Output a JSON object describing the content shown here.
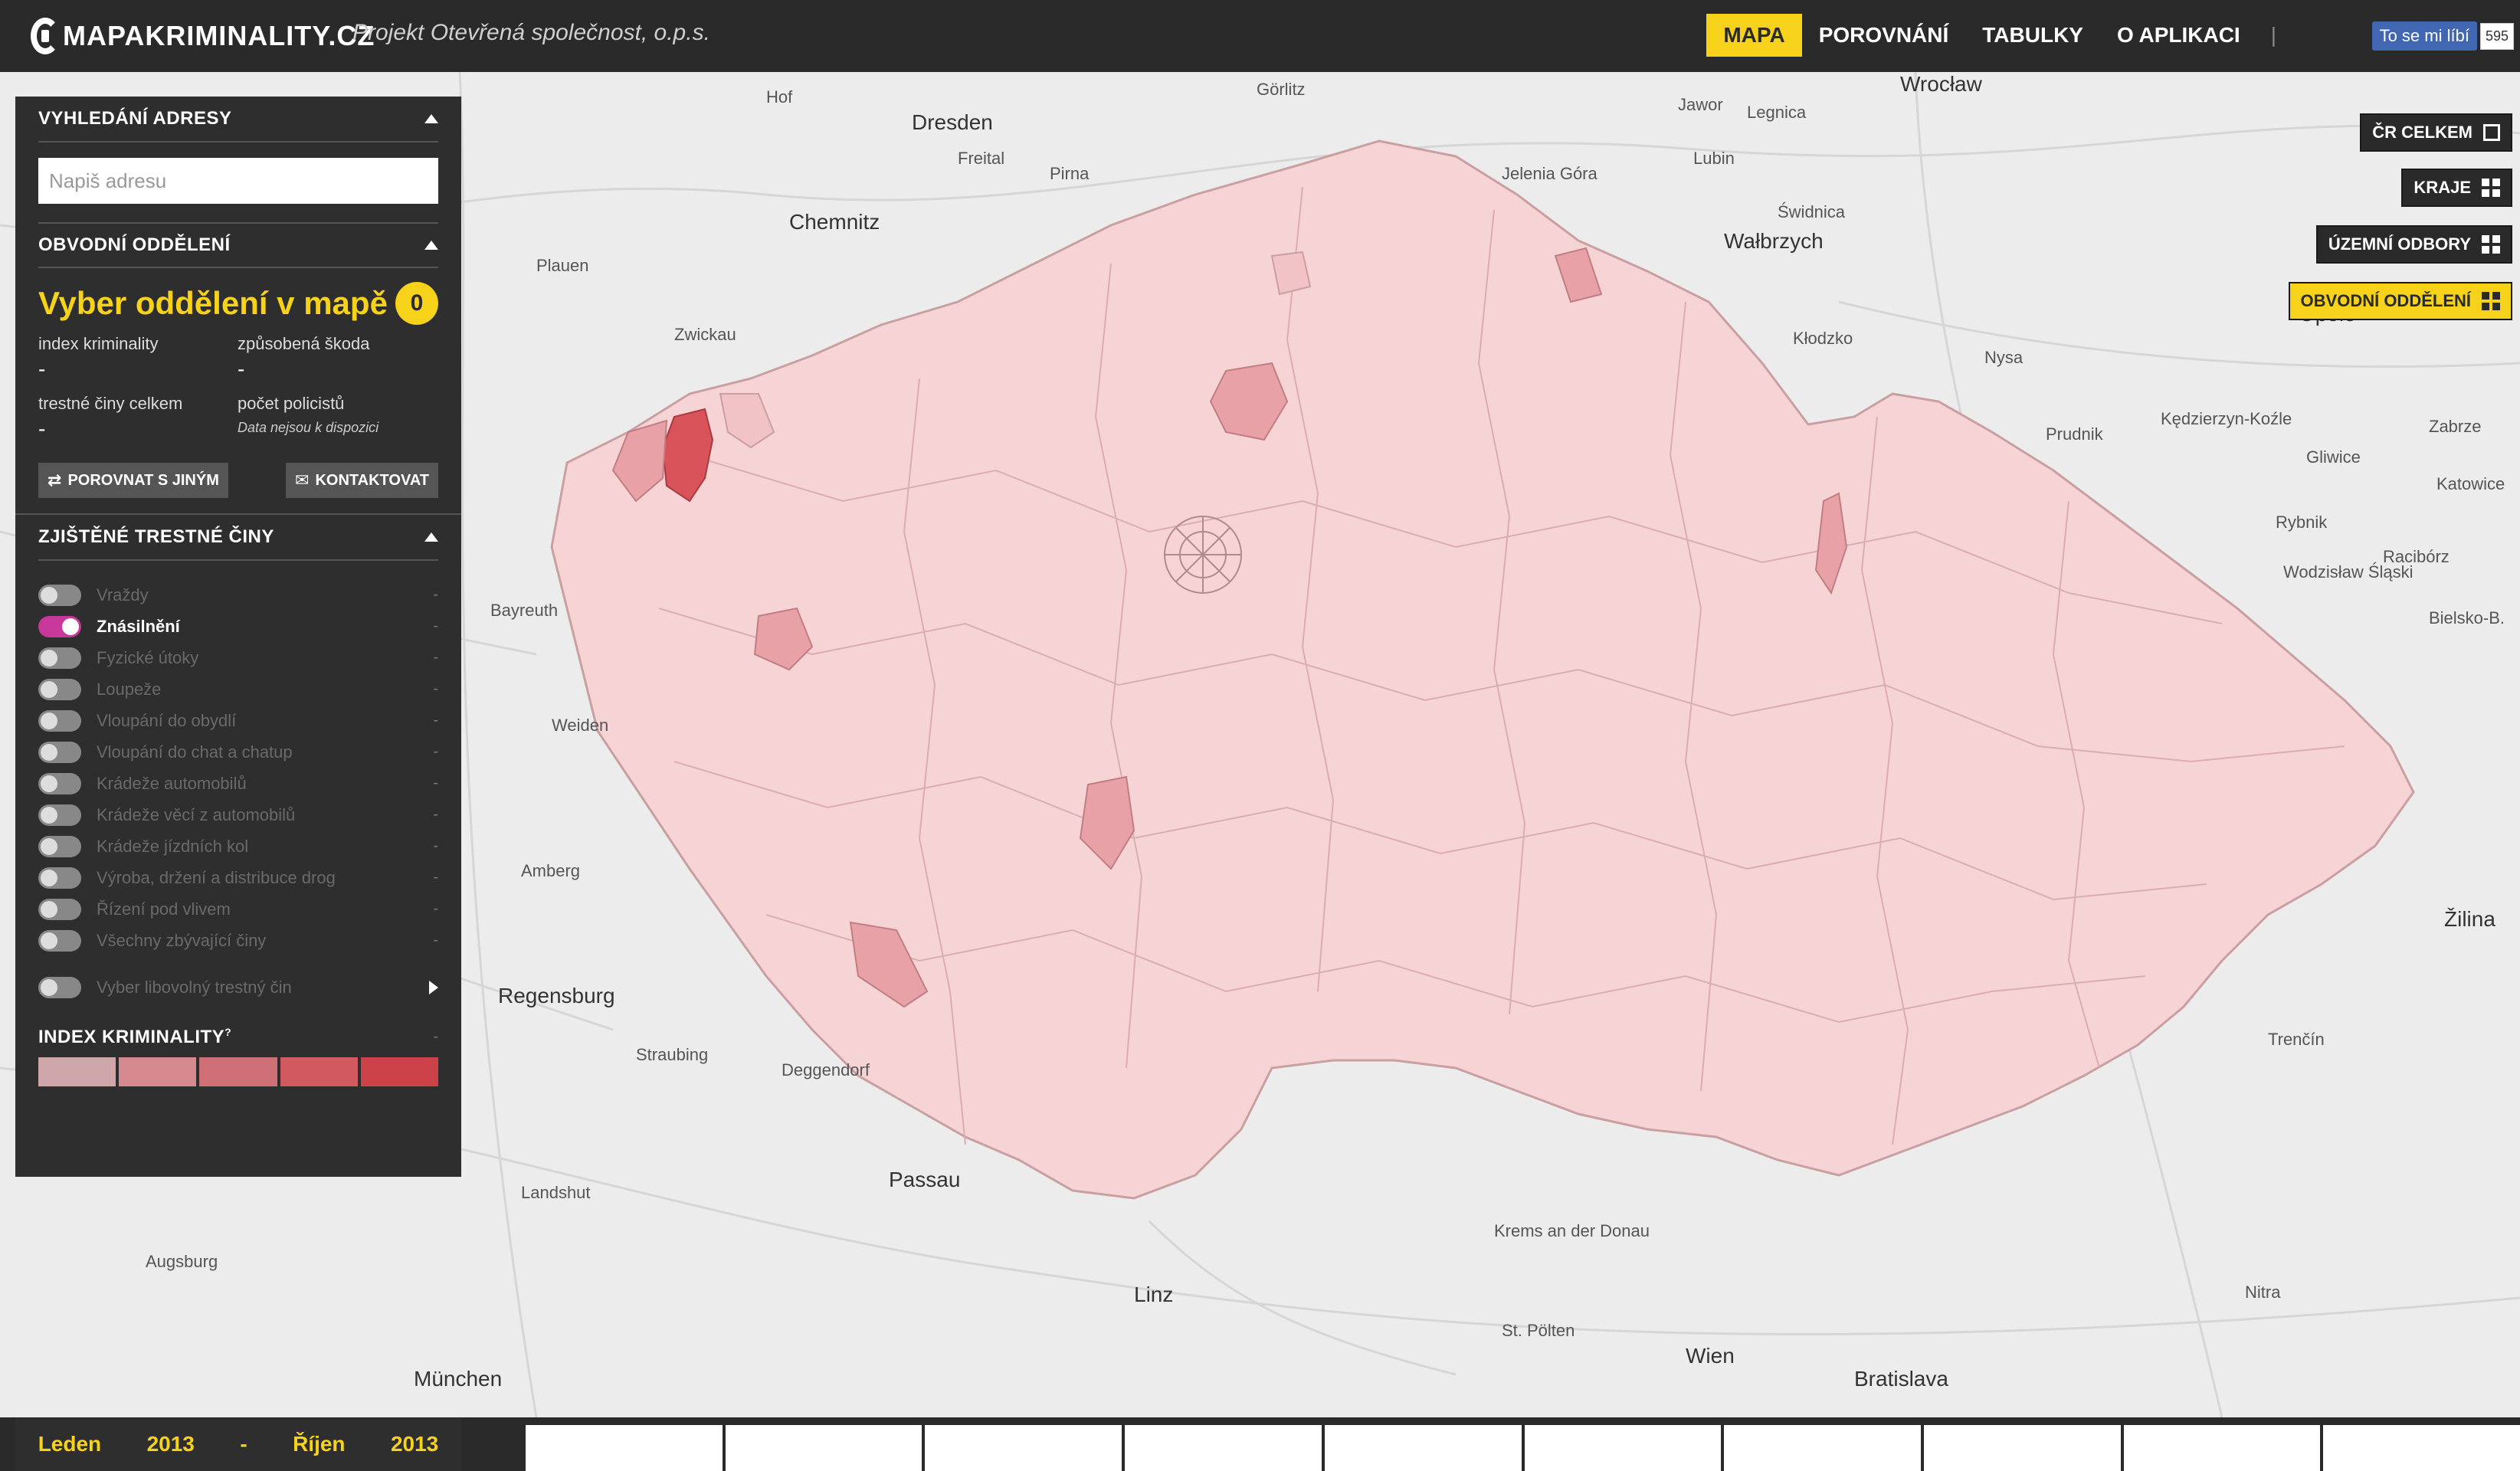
{
  "header": {
    "logo_text": "MAPAKRIMINALITY.CZ",
    "project_text": "Projekt Otevřená společnost, o.p.s.",
    "nav": [
      {
        "label": "MAPA",
        "active": true
      },
      {
        "label": "POROVNÁNÍ",
        "active": false
      },
      {
        "label": "TABULKY",
        "active": false
      },
      {
        "label": "O APLIKACI",
        "active": false
      }
    ],
    "separator": "|",
    "facebook": {
      "label": "To se mi líbí",
      "count": "595"
    }
  },
  "layers": [
    {
      "label": "ČR CELKEM",
      "active": false,
      "icon": "square-icon"
    },
    {
      "label": "KRAJE",
      "active": false,
      "icon": "grid-icon"
    },
    {
      "label": "ÚZEMNÍ ODBORY",
      "active": false,
      "icon": "grid-icon"
    },
    {
      "label": "OBVODNÍ ODDĚLENÍ",
      "active": true,
      "icon": "grid-icon"
    }
  ],
  "panel": {
    "address": {
      "title": "VYHLEDÁNÍ ADRESY",
      "placeholder": "Napiš adresu"
    },
    "department": {
      "title": "OBVODNÍ ODDĚLENÍ",
      "select_title": "Vyber oddělení v mapě",
      "count": "0",
      "stats": {
        "index_label": "index kriminality",
        "index_value": "-",
        "damage_label": "způsobená škoda",
        "damage_value": "-",
        "crimes_label": "trestné činy celkem",
        "crimes_value": "-",
        "police_label": "počet policistů",
        "police_note": "Data nejsou k dispozici"
      },
      "compare_label": "POROVNAT S JINÝM",
      "contact_label": "KONTAKTOVAT"
    },
    "crimes": {
      "title": "ZJIŠTĚNÉ TRESTNÉ ČINY",
      "items": [
        {
          "label": "Vraždy",
          "on": false,
          "value": "-"
        },
        {
          "label": "Znásilnění",
          "on": true,
          "value": "-"
        },
        {
          "label": "Fyzické útoky",
          "on": false,
          "value": "-"
        },
        {
          "label": "Loupeže",
          "on": false,
          "value": "-"
        },
        {
          "label": "Vloupání do obydlí",
          "on": false,
          "value": "-"
        },
        {
          "label": "Vloupání do chat a chatup",
          "on": false,
          "value": "-"
        },
        {
          "label": "Krádeže automobilů",
          "on": false,
          "value": "-"
        },
        {
          "label": "Krádeže věcí z automobilů",
          "on": false,
          "value": "-"
        },
        {
          "label": "Krádeže jízdních kol",
          "on": false,
          "value": "-"
        },
        {
          "label": "Výroba, držení a distribuce drog",
          "on": false,
          "value": "-"
        },
        {
          "label": "Řízení pod vlivem",
          "on": false,
          "value": "-"
        },
        {
          "label": "Všechny zbývající činy",
          "on": false,
          "value": "-"
        }
      ],
      "any_label": "Vyber libovolný trestný čin"
    },
    "legend": {
      "title": "INDEX KRIMINALITY",
      "marker": "?",
      "dash": "-",
      "colors": [
        "#cfa7aa",
        "#d48a8f",
        "#cf6f76",
        "#d2595f",
        "#cc4248"
      ]
    }
  },
  "period": {
    "from_month": "Leden",
    "from_year": "2013",
    "dash": "-",
    "to_month": "Říjen",
    "to_year": "2013"
  },
  "map": {
    "fill_color": "#f6d3d5",
    "highlight_colors": [
      "#e8a2a7",
      "#d9535b"
    ],
    "labels": [
      "Wrocław",
      "Dresden",
      "Chemnitz",
      "Görlitz",
      "Świdnica",
      "Wałbrzych",
      "Jelenia Góra",
      "Kłodzko",
      "Opole",
      "Gliwice",
      "Katowice",
      "Zabrze",
      "Bielsko-B.",
      "Rybnik",
      "Regensburg",
      "Passau",
      "Linz",
      "Wien",
      "Bratislava",
      "Landshut",
      "München",
      "Augsburg",
      "St. Pölten",
      "Krems an der Donau",
      "Trenčín",
      "Žilina",
      "Nitra",
      "Zwickau",
      "Plauen",
      "Bayreuth",
      "Weiden",
      "Amberg",
      "Straubing",
      "Deggendorf",
      "Prudnik",
      "Nysa",
      "Racibórz",
      "Wodzisław Śląski",
      "Kędzierzyn-Koźle",
      "Hof",
      "Freital",
      "Pirna",
      "Jawor",
      "Legnica",
      "Lubin"
    ]
  }
}
